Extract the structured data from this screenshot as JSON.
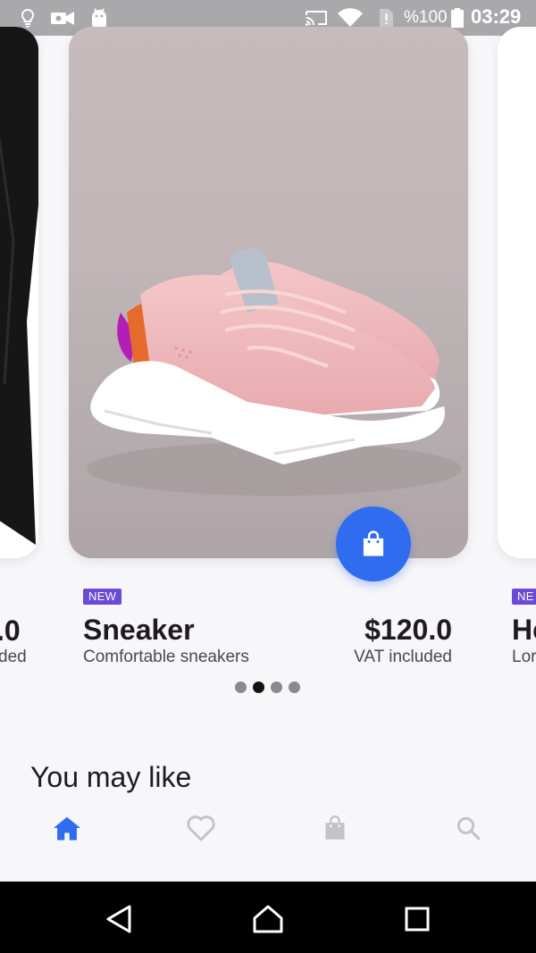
{
  "status_bar": {
    "battery_text": "%100",
    "time": "03:29",
    "icons": [
      "lightbulb-icon",
      "video-camera-icon",
      "android-icon",
      "cast-icon",
      "wifi-icon",
      "sim-alert-icon",
      "battery-icon"
    ]
  },
  "carousel": {
    "left_card": {
      "price_fragment": ".0",
      "vat_fragment": "ded"
    },
    "main_card": {
      "badge": "NEW",
      "name": "Sneaker",
      "description": "Comfortable sneakers",
      "price": "$120.0",
      "vat": "VAT included",
      "image": "pink-sneaker-photo",
      "favorite_icon": "heart-outline-icon",
      "cart_icon": "shopping-bag-icon",
      "cart_button_color": "#2f6cf0"
    },
    "right_card": {
      "badge_fragment": "NE",
      "name_fragment": "He",
      "description_fragment": "Lor"
    },
    "page_indicator": {
      "count": 4,
      "active_index": 1
    }
  },
  "section": {
    "title": "You may like"
  },
  "bottom_nav": {
    "items": [
      {
        "icon": "home-icon",
        "active": true
      },
      {
        "icon": "heart-outline-icon",
        "active": false
      },
      {
        "icon": "shopping-bag-icon",
        "active": false
      },
      {
        "icon": "search-icon",
        "active": false
      }
    ],
    "active_color": "#2f6cf0",
    "inactive_color": "#c4c3c8"
  },
  "system_nav": {
    "icons": [
      "back-icon",
      "home-outline-icon",
      "recents-icon"
    ]
  },
  "colors": {
    "accent": "#2f6cf0",
    "badge": "#6b4ad6",
    "background": "#f7f6f9"
  }
}
